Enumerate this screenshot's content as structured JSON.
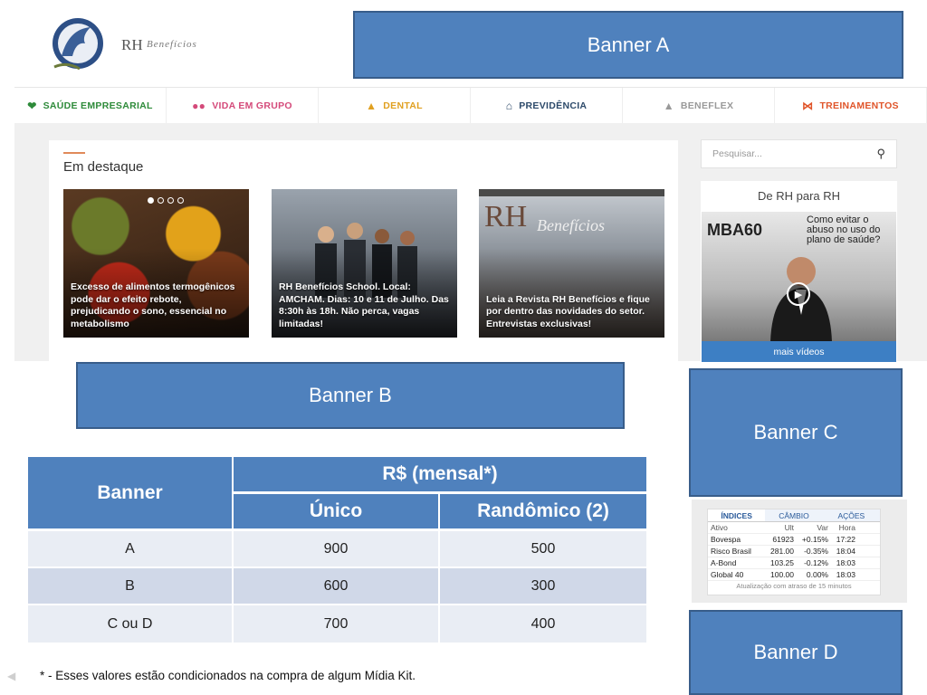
{
  "logo": {
    "main": "RH",
    "sub": "Benefícios"
  },
  "banners": {
    "a": "Banner A",
    "b": "Banner B",
    "c": "Banner C",
    "d": "Banner D"
  },
  "nav": [
    {
      "label": "SAÚDE EMPRESARIAL",
      "icon": "heartbeat-icon",
      "color": "#2e8b3a"
    },
    {
      "label": "VIDA EM GRUPO",
      "icon": "users-icon",
      "color": "#d44a7a"
    },
    {
      "label": "DENTAL",
      "icon": "tooth-icon",
      "color": "#e0a020"
    },
    {
      "label": "PREVIDÊNCIA",
      "icon": "home-icon",
      "color": "#2d4a6a"
    },
    {
      "label": "BENEFLEX",
      "icon": "thumbs-up-icon",
      "color": "#999999"
    },
    {
      "label": "TREINAMENTOS",
      "icon": "share-icon",
      "color": "#e0552a"
    }
  ],
  "featured": {
    "title": "Em destaque",
    "cards": [
      {
        "caption": "Excesso de alimentos termogênicos pode dar o efeito rebote, prejudicando o sono, essencial no metabolismo"
      },
      {
        "caption": "RH Benefícios School. Local: AMCHAM. Dias: 10 e 11 de Julho. Das 8:30h às 18h. Não perca, vagas limitadas!"
      },
      {
        "caption": "Leia a Revista RH Benefícios e fique por dentro das novidades do setor. Entrevistas exclusivas!"
      }
    ]
  },
  "sidebar": {
    "search_placeholder": "Pesquisar...",
    "rh_title": "De RH para RH",
    "video_brand": "MBA60",
    "video_question": "Como evitar o abuso no uso do plano de saúde?",
    "more_videos": "mais vídeos"
  },
  "price_table": {
    "col_banner": "Banner",
    "col_group": "R$ (mensal*)",
    "col_unico": "Único",
    "col_rand": "Randômico (2)",
    "rows": [
      {
        "banner": "A",
        "unico": "900",
        "rand": "500"
      },
      {
        "banner": "B",
        "unico": "600",
        "rand": "300"
      },
      {
        "banner": "C ou D",
        "unico": "700",
        "rand": "400"
      }
    ]
  },
  "ticker": {
    "tabs": [
      "ÍNDICES",
      "CÂMBIO",
      "AÇÕES"
    ],
    "headers": [
      "Ativo",
      "Ult",
      "Var",
      "Hora"
    ],
    "rows": [
      [
        "Bovespa",
        "61923",
        "+0.15%",
        "17:22"
      ],
      [
        "Risco Brasil",
        "281.00",
        "-0.35%",
        "18:04"
      ],
      [
        "A-Bond",
        "103.25",
        "-0.12%",
        "18:03"
      ],
      [
        "Global 40",
        "100.00",
        "0.00%",
        "18:03"
      ]
    ],
    "footer": "Atualização com atraso de 15 minutos"
  },
  "footnote": "* - Esses valores estão condicionados na compra de algum Mídia Kit."
}
